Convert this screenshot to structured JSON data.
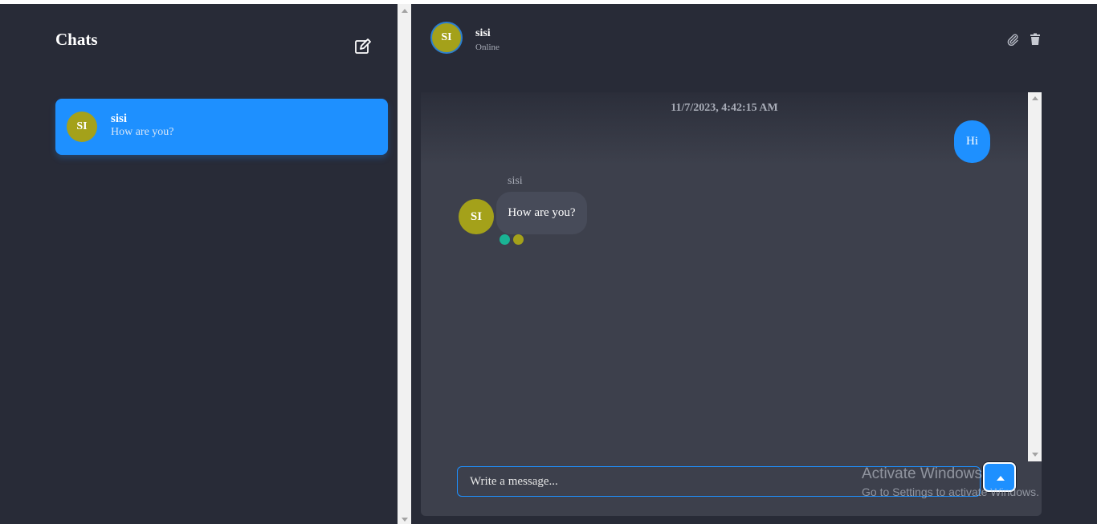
{
  "sidebar": {
    "title": "Chats",
    "compose_icon": "compose-icon",
    "chats": [
      {
        "initials": "SI",
        "name": "sisi",
        "preview": "How are you?",
        "active": true
      }
    ]
  },
  "header": {
    "initials": "SI",
    "name": "sisi",
    "status": "Online",
    "icons": [
      "paperclip-icon",
      "trash-icon"
    ]
  },
  "messages": {
    "timestamp": "11/7/2023, 4:42:15 AM",
    "outgoing": [
      {
        "text": "Hi"
      }
    ],
    "incoming": [
      {
        "sender": "sisi",
        "initials": "SI",
        "text": "How are you?"
      }
    ]
  },
  "composer": {
    "placeholder": "Write a message...",
    "send_icon": "send-arrow-icon"
  },
  "watermark": {
    "line1": "Activate Windows",
    "line2": "Go to Settings to activate Windows."
  },
  "colors": {
    "background": "#282b37",
    "accent": "#1e90ff",
    "avatar": "#a4a11a",
    "panel": "#3d404c",
    "incoming_bubble": "#474b59",
    "status_dot_green": "#1ab394"
  }
}
